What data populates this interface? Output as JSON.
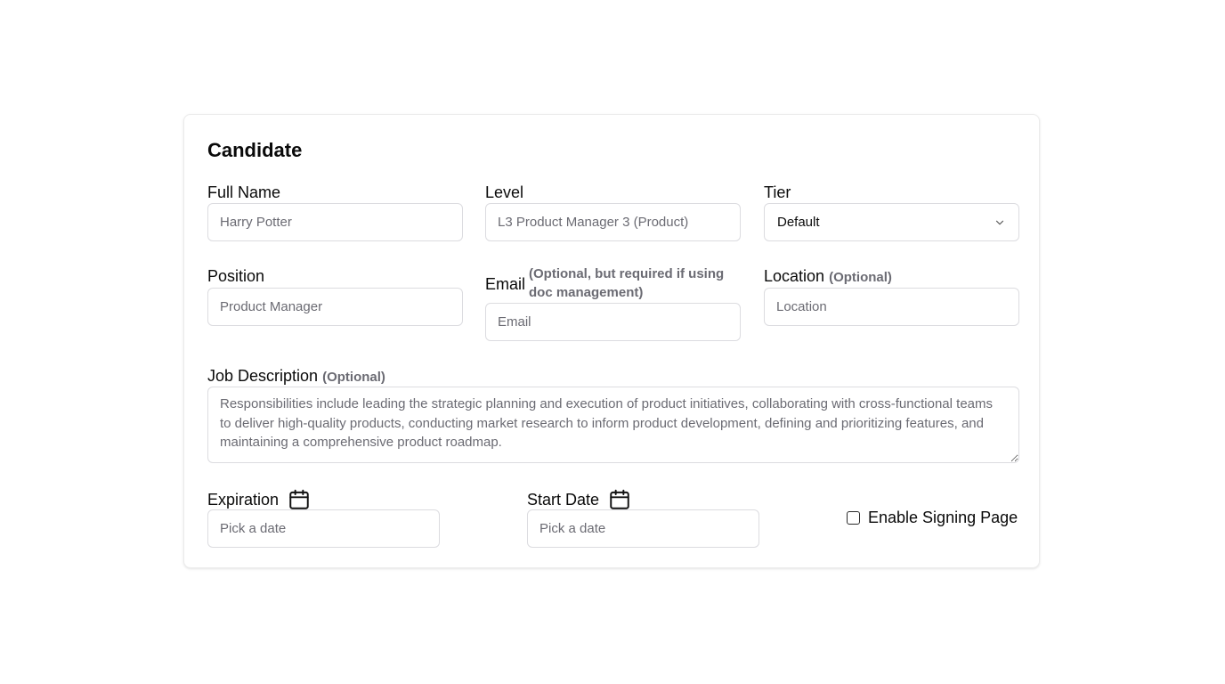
{
  "card": {
    "title": "Candidate"
  },
  "fields": {
    "full_name": {
      "label": "Full Name",
      "placeholder": "Harry Potter",
      "value": ""
    },
    "level": {
      "label": "Level",
      "placeholder": "L3 Product Manager 3 (Product)",
      "value": ""
    },
    "tier": {
      "label": "Tier",
      "selected": "Default"
    },
    "position": {
      "label": "Position",
      "placeholder": "Product Manager",
      "value": ""
    },
    "email": {
      "label": "Email",
      "optional_note_line1": "(Optional, but required if using",
      "optional_note_line2": "doc management)",
      "placeholder": "Email",
      "value": ""
    },
    "location": {
      "label": "Location",
      "optional_note": "(Optional)",
      "placeholder": "Location",
      "value": ""
    },
    "job_description": {
      "label": "Job Description",
      "optional_note": "(Optional)",
      "placeholder": "Responsibilities include leading the strategic planning and execution of product initiatives, collaborating with cross-functional teams to deliver high-quality products, conducting market research to inform product development, defining and prioritizing features, and maintaining a comprehensive product roadmap.",
      "value": ""
    },
    "expiration": {
      "label": "Expiration",
      "placeholder": "Pick a date",
      "icon": "calendar-icon"
    },
    "start_date": {
      "label": "Start Date",
      "placeholder": "Pick a date",
      "icon": "calendar-icon"
    },
    "signing": {
      "label": "Enable Signing Page",
      "checked": false
    }
  },
  "icons": {
    "select_chevron": "chevron-down-icon"
  }
}
